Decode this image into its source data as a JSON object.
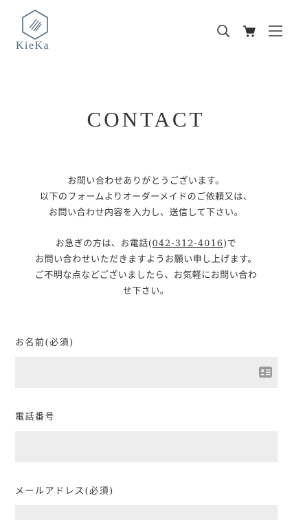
{
  "brand": {
    "name": "KieKa",
    "logo_color": "#556a7e"
  },
  "header": {
    "icons": [
      "search-icon",
      "cart-icon",
      "menu-icon"
    ]
  },
  "page": {
    "title": "CONTACT"
  },
  "intro": {
    "para1": {
      "line1": "お問い合わせありがとうございます。",
      "line2": "以下のフォームよりオーダーメイドのご依頼又は、",
      "line3": "お問い合わせ内容を入力し、送信して下さい。"
    },
    "para2": {
      "prefix": "お急ぎの方は、お電話(",
      "phone": "042-312-4016",
      "suffix": ")で",
      "line2": "お問い合わせいただきますようお願い申し上げます。",
      "line3": "ご不明な点などございましたら、お気軽にお問い合わ",
      "line4": "せ下さい。"
    }
  },
  "form": {
    "name_label": "お名前(必須)",
    "name_value": "",
    "phone_label": "電話番号",
    "phone_value": "",
    "email_label": "メールアドレス(必須)",
    "email_value": "",
    "input_bg": "#ededed"
  }
}
